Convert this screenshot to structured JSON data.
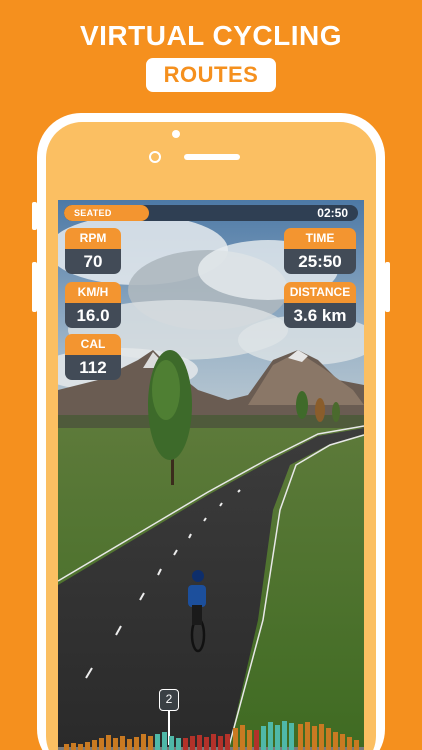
{
  "header": {
    "title": "VIRTUAL CYCLING",
    "subtitle": "ROUTES"
  },
  "ride": {
    "position_label": "SEATED",
    "elapsed": "02:50",
    "progress": 0.29
  },
  "stats_left": [
    {
      "label": "RPM",
      "value": "70"
    },
    {
      "label": "KM/H",
      "value": "16.0"
    },
    {
      "label": "CAL",
      "value": "112"
    }
  ],
  "stats_right": [
    {
      "label": "TIME",
      "value": "25:50"
    },
    {
      "label": "DISTANCE",
      "value": "3.6 km"
    }
  ],
  "lap_marker": "2",
  "colors": {
    "background": "#f5901e",
    "accent": "#f39530",
    "card_dark": "#424b57"
  },
  "icons": [
    "camera-dot",
    "speaker"
  ]
}
